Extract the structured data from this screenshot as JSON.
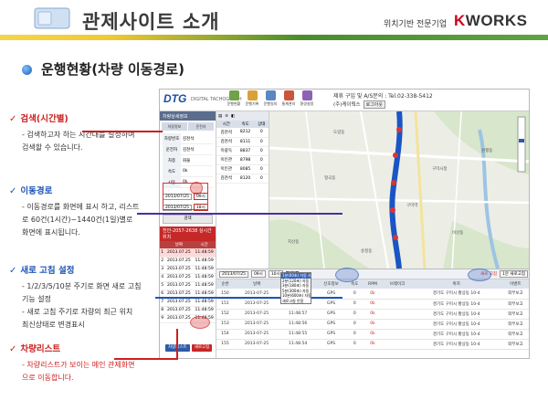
{
  "header": {
    "title": "관제사이트 소개",
    "tagline": "위치기반 전문기업",
    "brand_k": "K",
    "brand_rest": "WORKS"
  },
  "section": {
    "title": "운행현황(차량 이동경로)"
  },
  "annotations": [
    {
      "heading": "검색(시간별)",
      "color": "red",
      "lines": [
        "- 검색하고자 하는 시간대를 설정하여",
        "  검색할 수 있습니다."
      ]
    },
    {
      "heading": "이동경로",
      "color": "blue",
      "lines": [
        "- 이동경로를 화면에 표시 하고, 리스트",
        "  로  60건(1시간)~1440건(1일)별로",
        "  화면에 표시됩니다."
      ]
    },
    {
      "heading": "새로 고침 설정",
      "color": "blue",
      "lines": [
        "- 1/2/3/5/10분 주기로 화면 새로 고침",
        "  기능 설정",
        "- 새로 고침 주기로 차량의 최근 위치",
        "  최신상태로 변경표시"
      ]
    },
    {
      "heading": "차량리스트",
      "color": "red",
      "lines": [
        "- 차량리스트가 보이는 메인 관제화면",
        "  으로 이동합니다."
      ]
    }
  ],
  "app": {
    "logo": "DTG",
    "logo_sub": "DIGITAL TACHOGRAPH",
    "top_icons": [
      {
        "label": "운행현황",
        "color": "#6fa24a"
      },
      {
        "label": "운행기록",
        "color": "#d9a13a"
      },
      {
        "label": "운행일지",
        "color": "#5b86c4"
      },
      {
        "label": "통계관리",
        "color": "#c9553d"
      },
      {
        "label": "환경설정",
        "color": "#8a63b5"
      }
    ],
    "company_info": "제휴 구입 및 A/S문의 : Tel.02-338-5412",
    "user_info": "(주)케이웍스",
    "logout": "로그아웃",
    "sidebar_title": "차량상세정보",
    "sidebar_tabs": [
      "차량정보",
      "운전자"
    ],
    "sidebar_fields": [
      {
        "k": "차량번호",
        "v": "김천석"
      },
      {
        "k": "운전자",
        "v": "김천석"
      },
      {
        "k": "차종",
        "v": "화물"
      },
      {
        "k": "속도",
        "v": "0k"
      },
      {
        "k": "시동",
        "v": "0k"
      }
    ],
    "start_date": "2013/07/25",
    "start_hour": "09시",
    "end_date": "2013/07/25",
    "end_hour": "18시",
    "search_label": "검색",
    "vehicle_banner": "천안-2057-2638 실시간 위치",
    "sidebar_table_headers": [
      "",
      "날짜",
      "시간"
    ],
    "sidebar_table_rows": [
      [
        "1",
        "2013.07.25",
        "11:48:59"
      ],
      [
        "2",
        "2013.07.25",
        "11:48:59"
      ],
      [
        "3",
        "2013.07.25",
        "11:48:59"
      ],
      [
        "4",
        "2013.07.25",
        "11:48:59"
      ],
      [
        "5",
        "2013.07.25",
        "11:48:59"
      ],
      [
        "6",
        "2013.07.25",
        "11:48:59"
      ],
      [
        "7",
        "2013.07.25",
        "11:48:59"
      ],
      [
        "8",
        "2013.07.25",
        "11:48:59"
      ],
      [
        "9",
        "2013.07.25",
        "11:48:59"
      ]
    ],
    "sidebar_buttons": [
      "차량리스트",
      "새로고침"
    ],
    "list_headers": [
      "시간",
      "속도",
      "상태"
    ],
    "list_rows": [
      [
        "김천석",
        "8212",
        "0"
      ],
      [
        "김천석",
        "8111",
        "0"
      ],
      [
        "이광득",
        "8837",
        "0"
      ],
      [
        "이인관",
        "8798",
        "0"
      ],
      [
        "이인관",
        "8085",
        "0"
      ],
      [
        "김천석",
        "8120",
        "0"
      ]
    ],
    "map_labels": [
      "구미시청",
      "원평동",
      "구미역",
      "형곡동",
      "도량동",
      "지산동",
      "비산동",
      "송정동"
    ],
    "bottom_bar": {
      "date": "2013/07/25",
      "hour_start": "09시",
      "hour_end": "10시",
      "search": "검색",
      "refresh_note": "새로 고침",
      "refresh_select": "1분 새로고침"
    },
    "refresh_options": [
      "1분(60초) 자동 새로고침",
      "2분(120초) 자동 새로고침",
      "3분(180초) 자동 새로고침",
      "5분(300초) 자동 새로고침",
      "10분(600초) 자동 새로고침",
      "새로고침 안함"
    ],
    "bottom_headers": [
      "순번",
      "날짜",
      "시간",
      "신호정보",
      "속도",
      "RPM",
      "브레이크",
      "위치",
      "이벤트"
    ],
    "bottom_rows": [
      [
        "150",
        "2013-07-25",
        "11:48:59",
        "GPS",
        "0",
        "0k",
        "",
        "경기도 구미시 황상동 10-4",
        "외부보고"
      ],
      [
        "151",
        "2013-07-25",
        "11:48:58",
        "GPS",
        "0",
        "0k",
        "",
        "경기도 구미시 황상동 10-4",
        "외부보고"
      ],
      [
        "152",
        "2013-07-25",
        "11:48:57",
        "GPS",
        "0",
        "0k",
        "",
        "경기도 구미시 황상동 10-4",
        "외부보고"
      ],
      [
        "153",
        "2013-07-25",
        "11:48:56",
        "GPS",
        "0",
        "0k",
        "",
        "경기도 구미시 황상동 10-4",
        "외부보고"
      ],
      [
        "154",
        "2013-07-25",
        "11:48:55",
        "GPS",
        "0",
        "0k",
        "",
        "경기도 구미시 황상동 10-4",
        "외부보고"
      ],
      [
        "155",
        "2013-07-25",
        "11:48:54",
        "GPS",
        "0",
        "0k",
        "",
        "경기도 구미시 황상동 10-4",
        "외부보고"
      ]
    ]
  },
  "colors": {
    "red_accent": "#cc1f1f",
    "blue_accent": "#1f55b8",
    "route": "#1a55c4"
  }
}
